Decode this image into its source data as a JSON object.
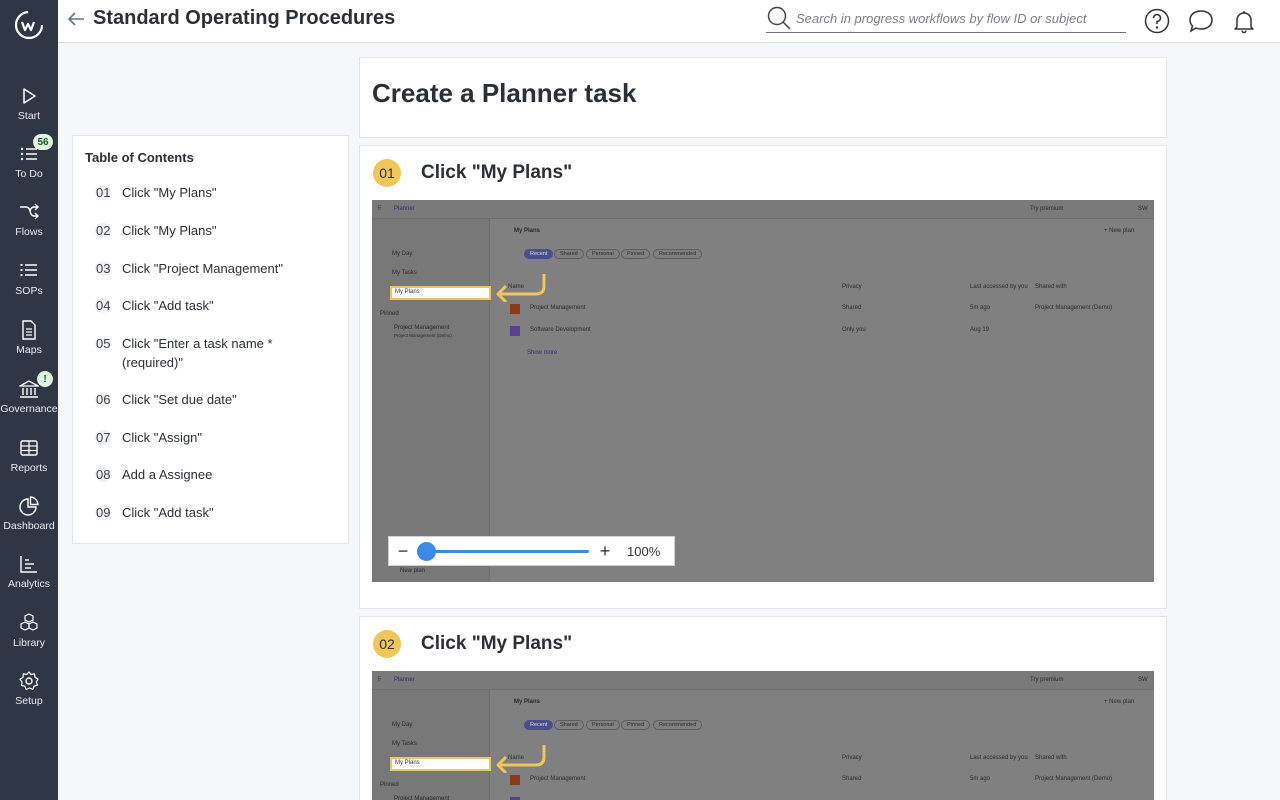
{
  "nav": {
    "items": [
      {
        "label": "Start"
      },
      {
        "label": "To Do",
        "badge": "56"
      },
      {
        "label": "Flows"
      },
      {
        "label": "SOPs"
      },
      {
        "label": "Maps"
      },
      {
        "label": "Governance",
        "badge": "!"
      },
      {
        "label": "Reports"
      },
      {
        "label": "Dashboard"
      },
      {
        "label": "Analytics"
      },
      {
        "label": "Library"
      },
      {
        "label": "Setup"
      }
    ]
  },
  "header": {
    "title": "Standard Operating Procedures",
    "search_placeholder": "Search in progress workflows by flow ID or subject"
  },
  "toc": {
    "title": "Table of Contents",
    "items": [
      {
        "num": "01",
        "label": "Click \"My Plans\""
      },
      {
        "num": "02",
        "label": "Click \"My Plans\""
      },
      {
        "num": "03",
        "label": "Click \"Project Management\""
      },
      {
        "num": "04",
        "label": "Click \"Add task\""
      },
      {
        "num": "05",
        "label": "Click \"Enter a task name * (required)\""
      },
      {
        "num": "06",
        "label": "Click \"Set due date\""
      },
      {
        "num": "07",
        "label": "Click \"Assign\""
      },
      {
        "num": "08",
        "label": "Add a Assignee"
      },
      {
        "num": "09",
        "label": "Click \"Add task\""
      }
    ]
  },
  "doc": {
    "title": "Create a Planner task"
  },
  "steps": [
    {
      "num": "01",
      "title": "Click \"My Plans\""
    },
    {
      "num": "02",
      "title": "Click \"My Plans\""
    }
  ],
  "planner": {
    "app": "Planner",
    "try_premium": "Try premium",
    "avatar": "SW",
    "heading": "My Plans",
    "new_plan": "+ New plan",
    "sidebar": {
      "my_day": "My Day",
      "my_tasks": "My Tasks",
      "my_plans": "My Plans",
      "pinned": "Pinned",
      "pinned_plan": "Project Management",
      "pinned_sub": "Project Management (Demo)",
      "new_plan": "New plan"
    },
    "filters": [
      "Recent",
      "Shared",
      "Personal",
      "Pinned",
      "Recommended"
    ],
    "columns": {
      "name": "Name",
      "privacy": "Privacy",
      "accessed": "Last accessed by you",
      "shared": "Shared with"
    },
    "rows": [
      {
        "name": "Project Management",
        "privacy": "Shared",
        "accessed": "5m ago",
        "shared": "Project Management (Demo)"
      },
      {
        "name": "Software Development",
        "privacy": "Only you",
        "accessed": "Aug 19",
        "shared": ""
      }
    ],
    "show_more": "Show more"
  },
  "zoom": {
    "level_label": "100%",
    "level": 0.0
  },
  "colors": {
    "nav_bg": "#2f3747",
    "step_badge": "#f0c55a",
    "zoom_accent": "#3a8be8"
  }
}
